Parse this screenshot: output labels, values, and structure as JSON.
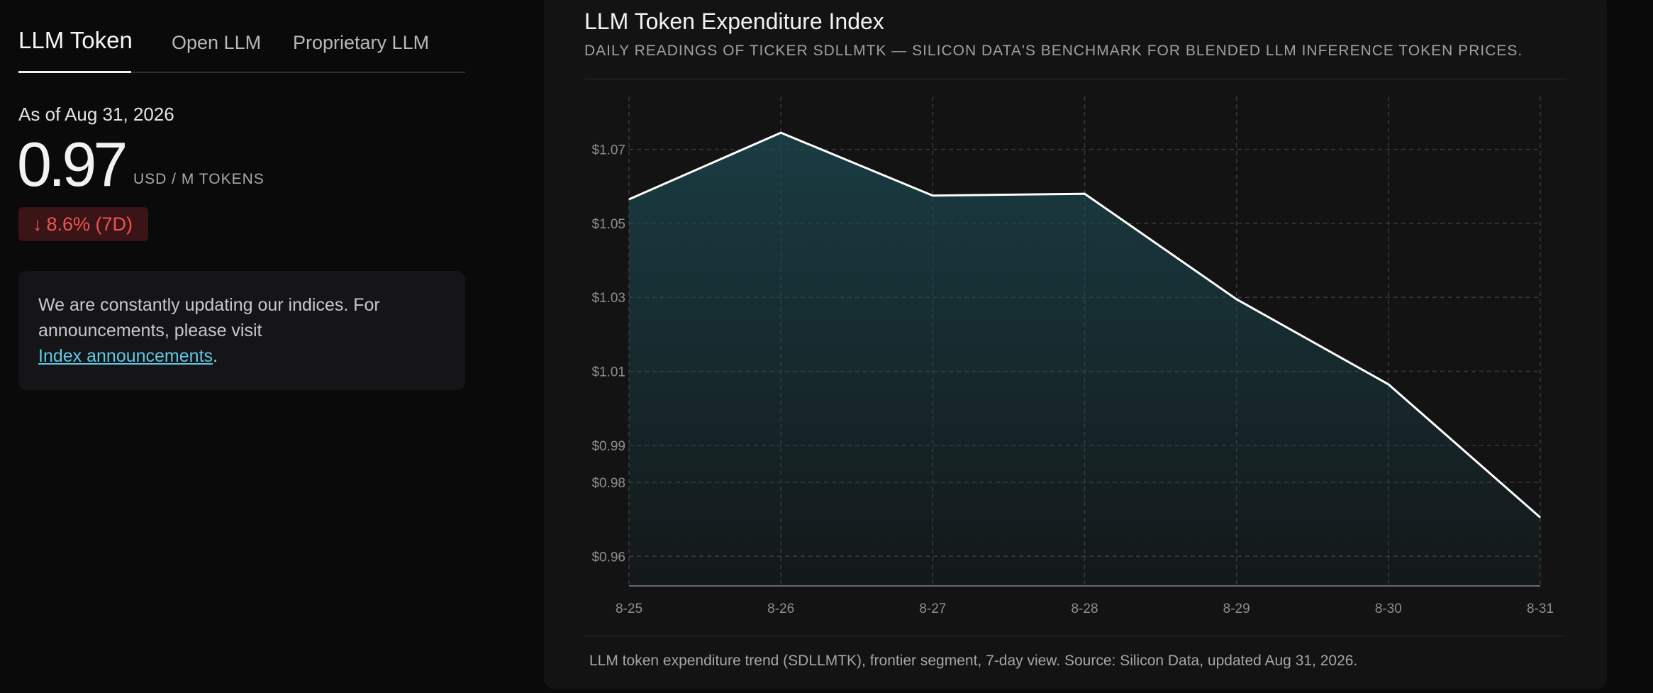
{
  "tabs": [
    {
      "label": "LLM Token",
      "active": true
    },
    {
      "label": "Open LLM",
      "active": false
    },
    {
      "label": "Proprietary LLM",
      "active": false
    }
  ],
  "summary": {
    "as_of": "As of Aug 31, 2026",
    "value": "0.97",
    "unit": "USD / M TOKENS",
    "change_arrow": "↓",
    "change": "8.6% (7D)",
    "change_color": "#ef5350"
  },
  "notice": {
    "text": "We are constantly updating our indices. For announcements, please visit",
    "link_label": "Index announcements",
    "suffix": "."
  },
  "card": {
    "title": "LLM Token Expenditure Index",
    "subtitle": "DAILY READINGS OF TICKER SDLLMTK — SILICON DATA'S BENCHMARK FOR BLENDED LLM INFERENCE TOKEN PRICES.",
    "caption": "LLM token expenditure trend (SDLLMTK), frontier segment, 7-day view. Source: Silicon Data, updated Aug 31, 2026."
  },
  "chart_data": {
    "type": "area",
    "title": "LLM Token Expenditure Index",
    "x": [
      "8-25",
      "8-26",
      "8-27",
      "8-28",
      "8-29",
      "8-30",
      "8-31"
    ],
    "series": [
      {
        "values": [
          1.0565,
          1.0745,
          1.0575,
          1.058,
          1.0295,
          1.0065,
          0.9705
        ]
      }
    ],
    "yticks": [
      0.96,
      0.98,
      0.99,
      1.01,
      1.03,
      1.05,
      1.07
    ],
    "ytick_labels": [
      "$0.96",
      "$0.98",
      "$0.99",
      "$1.01",
      "$1.03",
      "$1.05",
      "$1.07"
    ],
    "ylim": [
      0.952,
      1.082
    ],
    "grid": true,
    "line_color": "#ffffff",
    "fill_color": "#1b4a52"
  }
}
